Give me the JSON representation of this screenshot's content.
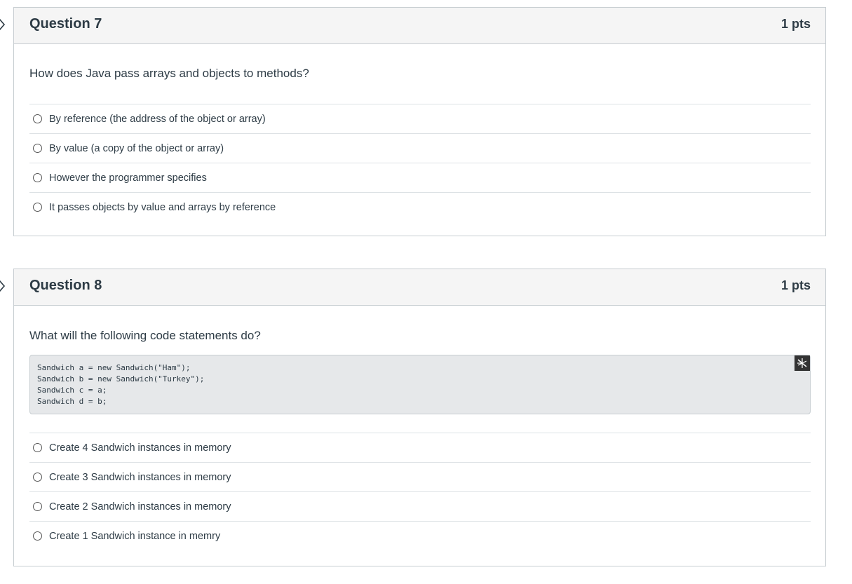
{
  "questions": [
    {
      "title": "Question 7",
      "points": "1 pts",
      "text": "How does Java pass arrays and objects to methods?",
      "answers": [
        "By reference (the address of the object or array)",
        "By value (a copy of the object or array)",
        "However the programmer specifies",
        "It passes objects by value and arrays by reference"
      ]
    },
    {
      "title": "Question 8",
      "points": "1 pts",
      "text": "What will the following code statements do?",
      "code": [
        "Sandwich a = new Sandwich(\"Ham\");",
        "Sandwich b = new Sandwich(\"Turkey\");",
        "Sandwich c = a;",
        "Sandwich d = b;"
      ],
      "answers": [
        "Create 4 Sandwich instances in memory",
        "Create 3 Sandwich instances in memory",
        "Create 2 Sandwich instances in memory",
        "Create 1 Sandwich instance in memry"
      ]
    }
  ],
  "icons": {
    "flag": "flag-question-icon",
    "code_tool": "code-tool-icon",
    "radio": "radio-button"
  }
}
